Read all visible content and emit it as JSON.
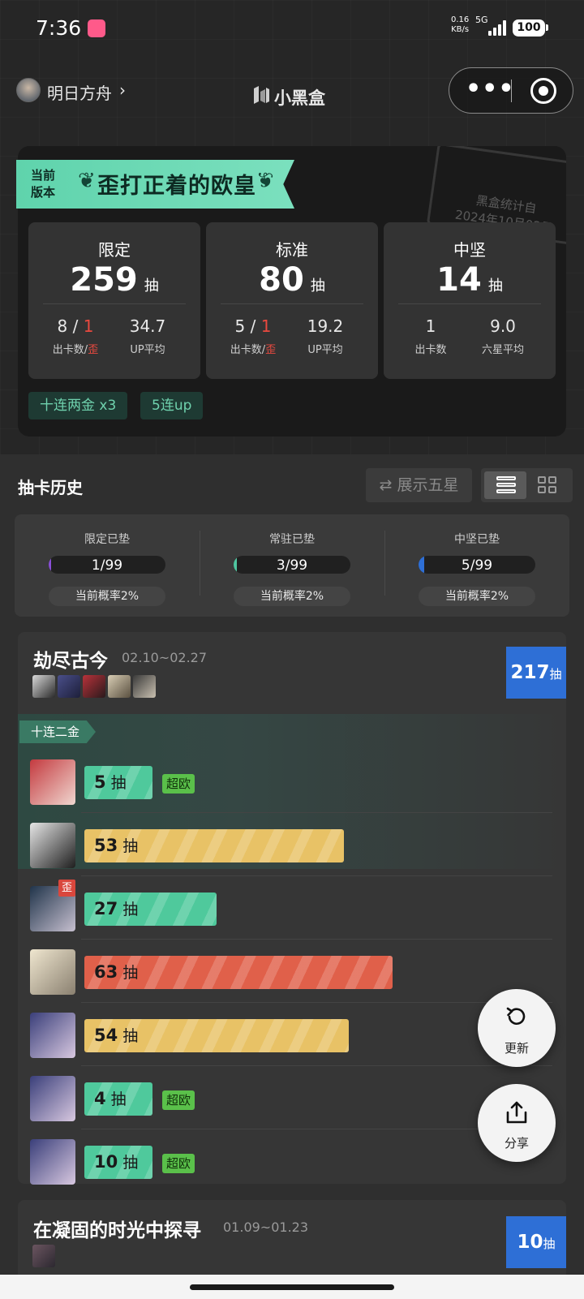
{
  "status_bar": {
    "time": "7:36",
    "net_speed_value": "0.16",
    "net_speed_unit": "KB/s",
    "net_type": "5G",
    "battery": "100"
  },
  "nav": {
    "game_name": "明日方舟",
    "logo_text": "小黑盒",
    "menu_icon": "more-dots-icon",
    "close_icon": "target-icon"
  },
  "summary": {
    "version_label_line1": "当前",
    "version_label_line2": "版本",
    "version_title": "歪打正着的欧皇",
    "stamp_line1": "黑盒统计自",
    "stamp_line2": "2024年10月02日",
    "stats": [
      {
        "title": "限定",
        "count": "259",
        "unit": "抽",
        "left_val_a": "8",
        "left_slash": "/",
        "left_val_b": "1",
        "left_cap_a": "出卡数",
        "left_cap_slash": "/",
        "left_cap_b": "歪",
        "right_val": "34.7",
        "right_cap": "UP平均"
      },
      {
        "title": "标准",
        "count": "80",
        "unit": "抽",
        "left_val_a": "5",
        "left_slash": "/",
        "left_val_b": "1",
        "left_cap_a": "出卡数",
        "left_cap_slash": "/",
        "left_cap_b": "歪",
        "right_val": "19.2",
        "right_cap": "UP平均"
      },
      {
        "title": "中坚",
        "count": "14",
        "unit": "抽",
        "left_val_a": "1",
        "left_cap_a": "出卡数",
        "right_val": "9.0",
        "right_cap": "六星平均"
      }
    ],
    "tags": [
      "十连两金  x3",
      "5连up"
    ]
  },
  "history": {
    "title": "抽卡历史",
    "show_five_label": "⇄ 展示五星",
    "pity": [
      {
        "title": "限定已垫",
        "value": "1/99",
        "progress": 0.0101,
        "color": "#8a4fd8",
        "rate": "当前概率2%"
      },
      {
        "title": "常驻已垫",
        "value": "3/99",
        "progress": 0.0303,
        "color": "#4fc6a0",
        "rate": "当前概率2%"
      },
      {
        "title": "中坚已垫",
        "value": "5/99",
        "progress": 0.0505,
        "color": "#2e6fd6",
        "rate": "当前概率2%"
      }
    ]
  },
  "banner1": {
    "name": "劫尽古今",
    "dates": "02.10~02.27",
    "total": "217",
    "total_unit": "抽",
    "ten_tag": "十连二金",
    "pulls": [
      {
        "count": "5",
        "unit": "抽",
        "badge": "超欧",
        "color": "#4fc99c",
        "wai": ""
      },
      {
        "count": "53",
        "unit": "抽",
        "badge": "",
        "color": "#e8c266",
        "wai": ""
      },
      {
        "count": "27",
        "unit": "抽",
        "badge": "",
        "color": "#4fc99c",
        "wai": "歪"
      },
      {
        "count": "63",
        "unit": "抽",
        "badge": "",
        "color": "#e0604a",
        "wai": ""
      },
      {
        "count": "54",
        "unit": "抽",
        "badge": "",
        "color": "#e8c266",
        "wai": ""
      },
      {
        "count": "4",
        "unit": "抽",
        "badge": "超欧",
        "color": "#4fc99c",
        "wai": ""
      },
      {
        "count": "10",
        "unit": "抽",
        "badge": "超欧",
        "color": "#4fc99c",
        "wai": ""
      }
    ]
  },
  "fab": {
    "refresh_label": "更新",
    "share_label": "分享"
  },
  "banner2": {
    "name": "在凝固的时光中探寻",
    "dates": "01.09~01.23",
    "total": "10",
    "total_unit": "抽"
  }
}
